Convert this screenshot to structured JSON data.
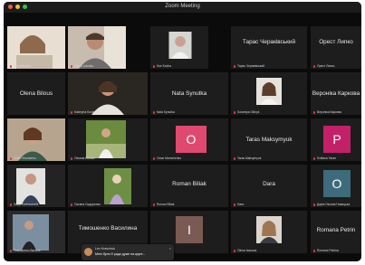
{
  "window": {
    "title": "Zoom Meeting"
  },
  "tiles": [
    {
      "label": "Щербишина"
    },
    {
      "label": "Olena Lokotko"
    },
    {
      "label": "Ihor Kucha"
    },
    {
      "name": "Тарас Чераківський",
      "label": "Тарас Чераківський"
    },
    {
      "name": "Орест Липко",
      "label": "Орест Липко"
    },
    {
      "name": "Olena Bilous",
      "label": ""
    },
    {
      "label": "Kateryna Kostenko"
    },
    {
      "name": "Nata Synutka",
      "label": "Nata Synutka"
    },
    {
      "label": "Solomiya Oliinyk"
    },
    {
      "name": "Вероніка Каркова",
      "label": "Вероніка Каркова"
    },
    {
      "label": "Yuliia Yevchenko"
    },
    {
      "label": "Oksana Bokaliv"
    },
    {
      "avatar": "O",
      "label": "Omar Mamchenko"
    },
    {
      "name": "Taras Maksymyuk",
      "label": "Taras Maksymyuk"
    },
    {
      "avatar": "P",
      "label": "Svitlana Yaran"
    },
    {
      "label": "Vasyl Karbovanets"
    },
    {
      "label": "Оксана Сидоренко"
    },
    {
      "name": "Roman Biliak",
      "label": "Roman Biliak"
    },
    {
      "name": "Dara",
      "label": "Dara"
    },
    {
      "avatar": "O",
      "label": "Дарія Оксана Новицька"
    },
    {
      "label": "Тимошенко Василь"
    },
    {
      "name": "Тимошенко Василина",
      "label": "Тимошенко Василина"
    },
    {
      "avatar": "I",
      "label": "Ivanna"
    },
    {
      "label": "Olena Ivanova"
    },
    {
      "name": "Romana Petrin",
      "label": "Romana Petrina"
    }
  ],
  "chat": {
    "from": "Lev Kravchuk",
    "message": "Мені було б радо дуже на круге...",
    "close": "×"
  },
  "colors": {
    "avatar_o": "#e0496f",
    "avatar_p": "#c2216a",
    "avatar_o2": "#3d6b7c",
    "avatar_i": "#7a5a52"
  }
}
